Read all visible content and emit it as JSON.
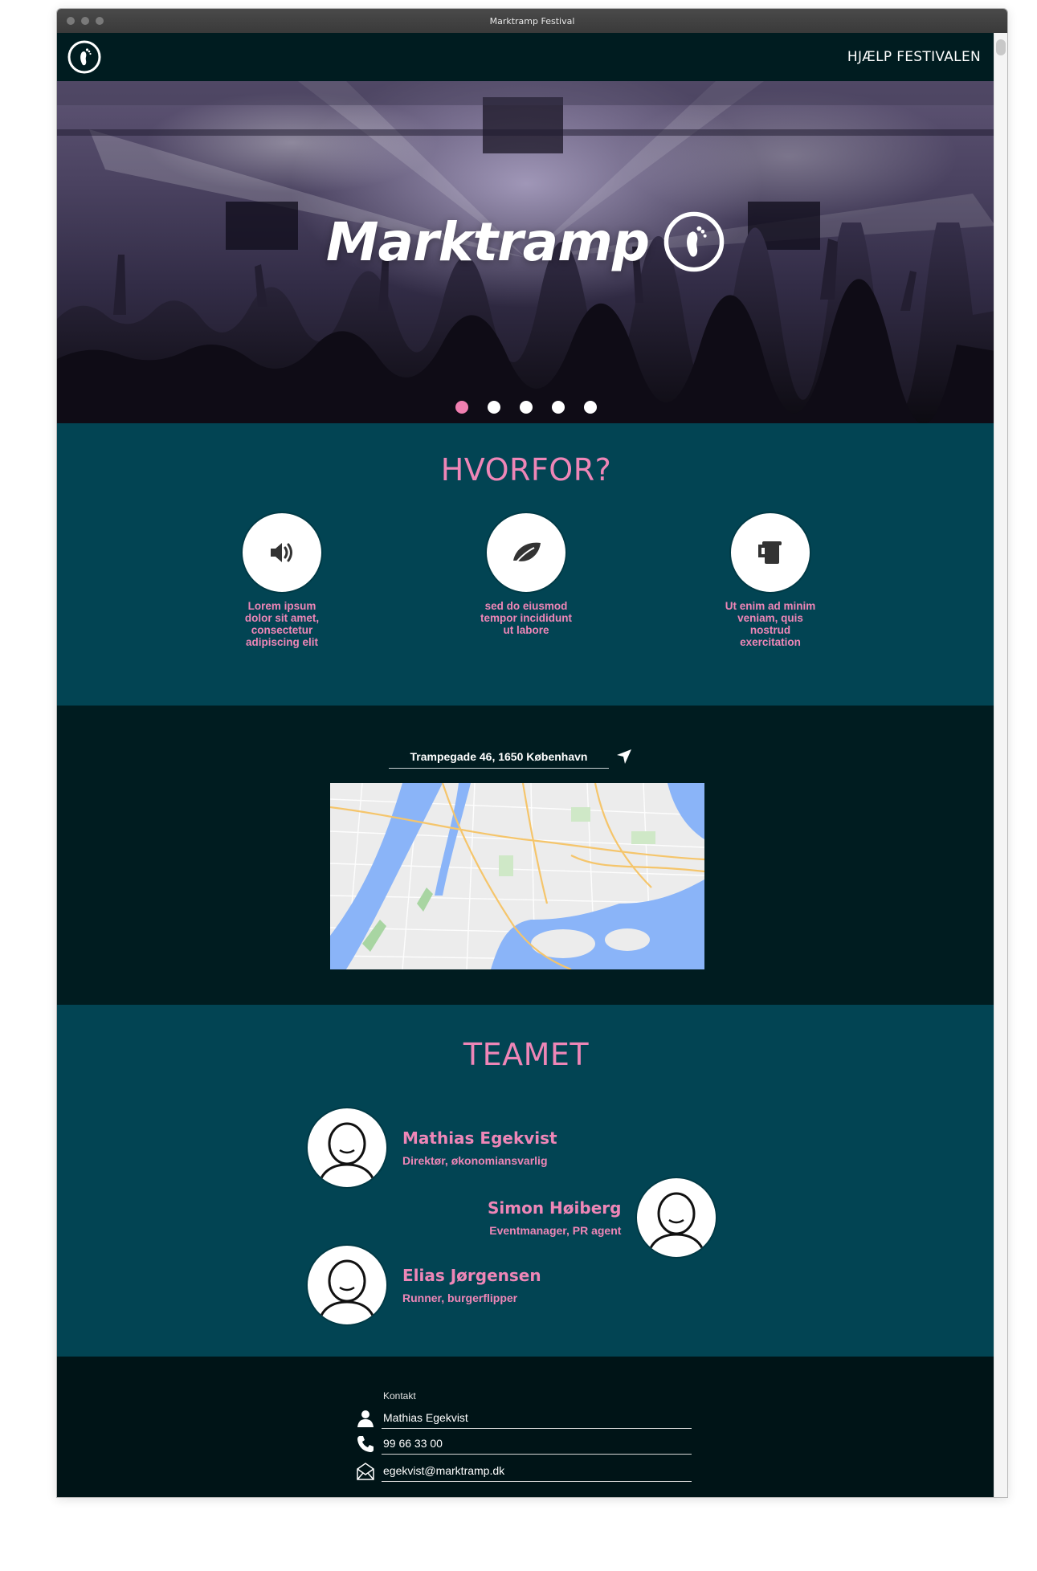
{
  "window": {
    "title": "Marktramp Festival"
  },
  "nav": {
    "logo_icon": "footprint-icon",
    "help_link": "HJÆLP FESTIVALEN"
  },
  "hero": {
    "wordmark": "Marktramp",
    "logo_icon": "footprint-icon",
    "slides": 5,
    "active_slide": 1
  },
  "why": {
    "title": "HVORFOR?",
    "features": [
      {
        "icon": "speaker-icon",
        "text": "Lorem ipsum dolor sit amet, consectetur adipiscing elit"
      },
      {
        "icon": "leaf-icon",
        "text": "sed do eiusmod tempor incididunt ut labore"
      },
      {
        "icon": "beer-mug-icon",
        "text": "Ut enim ad minim veniam, quis nostrud exercitation"
      }
    ]
  },
  "location": {
    "address": "Trampegade 46, 1650 København",
    "direction_icon": "navigation-arrow-icon"
  },
  "team": {
    "title": "TEAMET",
    "members": [
      {
        "name": "Mathias Egekvist",
        "role": "Direktør, økonomiansvarlig"
      },
      {
        "name": "Simon Høiberg",
        "role": "Eventmanager, PR agent"
      },
      {
        "name": "Elias Jørgensen",
        "role": "Runner, burgerflipper"
      }
    ]
  },
  "contact": {
    "heading": "Kontakt",
    "name": "Mathias Egekvist",
    "phone": "99 66 33 00",
    "email": "egekvist@marktramp.dk"
  },
  "colors": {
    "accent_pink": "#ee86b7",
    "teal": "#024453",
    "dark": "#001c20"
  }
}
